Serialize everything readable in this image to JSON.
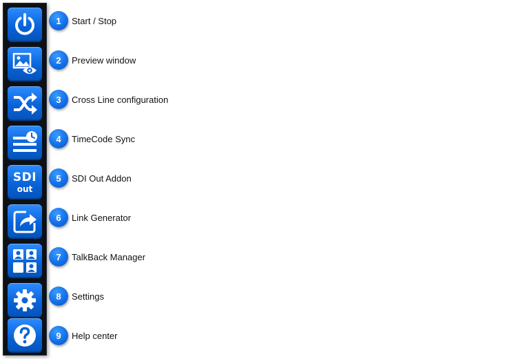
{
  "toolbar": {
    "buttons": [
      {
        "icon": "power-icon",
        "number": "1",
        "label": "Start / Stop"
      },
      {
        "icon": "preview-eye-icon",
        "number": "2",
        "label": "Preview window"
      },
      {
        "icon": "shuffle-icon",
        "number": "3",
        "label": "Cross Line configuration"
      },
      {
        "icon": "timecode-clock-icon",
        "number": "4",
        "label": "TimeCode Sync"
      },
      {
        "icon": "sdi-out-icon",
        "number": "5",
        "label": "SDI Out Addon",
        "icon_text_top": "SDI",
        "icon_text_bottom": "out"
      },
      {
        "icon": "share-arrow-icon",
        "number": "6",
        "label": "Link Generator"
      },
      {
        "icon": "talkback-users-icon",
        "number": "7",
        "label": "TalkBack Manager"
      },
      {
        "icon": "gear-icon",
        "number": "8",
        "label": "Settings"
      },
      {
        "icon": "help-question-icon",
        "number": "9",
        "label": "Help center"
      }
    ]
  },
  "colors": {
    "button_blue": "#0a63d8",
    "sidebar_bg": "#0d1117",
    "badge_blue": "#1370e8"
  }
}
